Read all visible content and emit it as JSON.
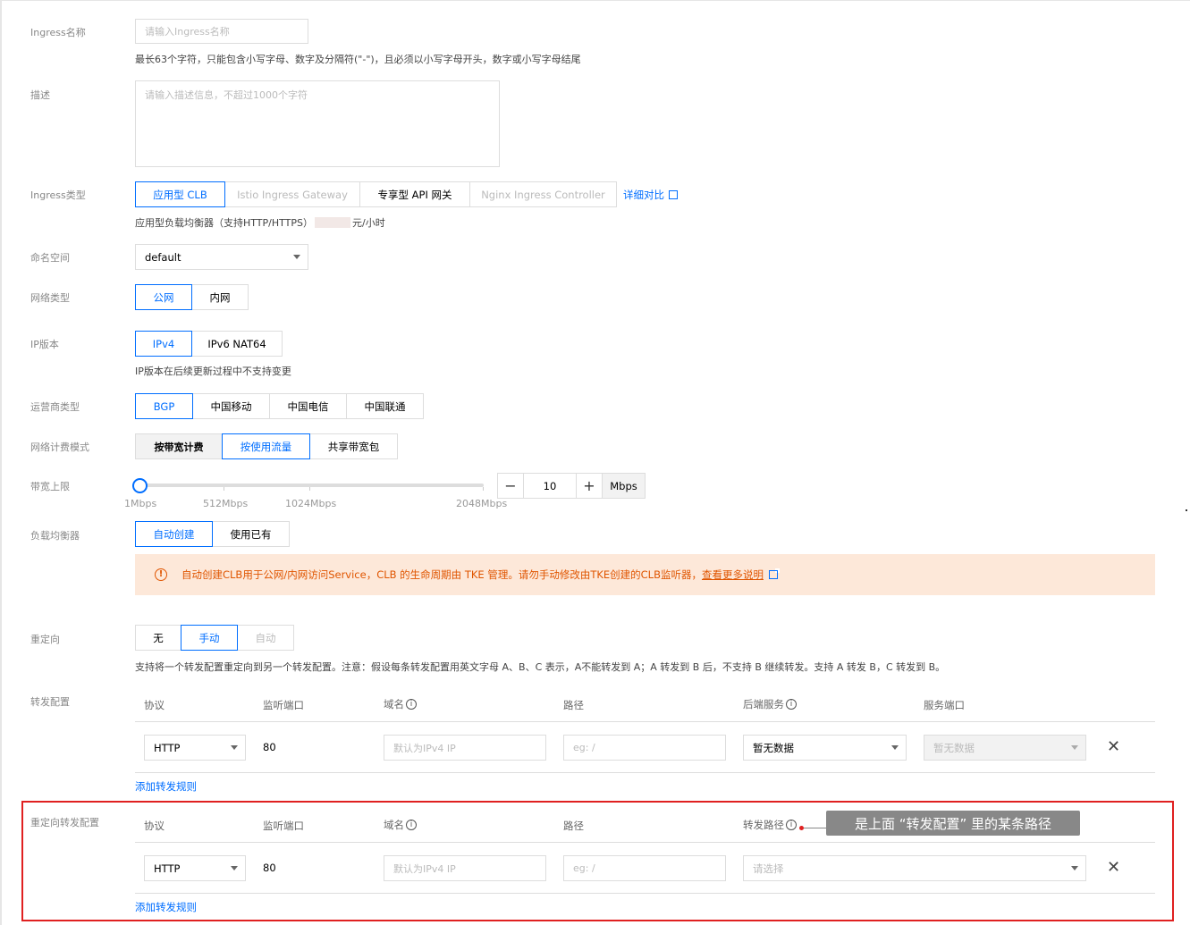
{
  "form": {
    "name": {
      "label": "Ingress名称",
      "placeholder": "请输入Ingress名称",
      "hint": "最长63个字符，只能包含小写字母、数字及分隔符(\"-\")，且必须以小写字母开头，数字或小写字母结尾"
    },
    "description": {
      "label": "描述",
      "placeholder": "请输入描述信息，不超过1000个字符"
    },
    "ingress_type": {
      "label": "Ingress类型",
      "options": [
        "应用型 CLB",
        "Istio Ingress Gateway",
        "专享型 API 网关",
        "Nginx Ingress Controller"
      ],
      "selected": "应用型 CLB",
      "compare_link": "详细对比",
      "hint_prefix": "应用型负载均衡器（支持HTTP/HTTPS）",
      "hint_suffix": "元/小时"
    },
    "namespace": {
      "label": "命名空间",
      "value": "default"
    },
    "network_type": {
      "label": "网络类型",
      "options": [
        "公网",
        "内网"
      ],
      "selected": "公网"
    },
    "ip_version": {
      "label": "IP版本",
      "options": [
        "IPv4",
        "IPv6 NAT64"
      ],
      "selected": "IPv4",
      "hint": "IP版本在后续更新过程中不支持变更"
    },
    "isp": {
      "label": "运营商类型",
      "options": [
        "BGP",
        "中国移动",
        "中国电信",
        "中国联通"
      ],
      "selected": "BGP"
    },
    "billing": {
      "label": "网络计费模式",
      "options": [
        "按带宽计费",
        "按使用流量",
        "共享带宽包"
      ],
      "selected": "按使用流量"
    },
    "bandwidth": {
      "label": "带宽上限",
      "ticks": [
        "1Mbps",
        "512Mbps",
        "1024Mbps",
        "2048Mbps"
      ],
      "value": "10",
      "unit": "Mbps",
      "minus": "−",
      "plus": "+",
      "level": 0
    },
    "load_balancer": {
      "label": "负载均衡器",
      "options": [
        "自动创建",
        "使用已有"
      ],
      "selected": "自动创建",
      "alert_text": "自动创建CLB用于公网/内网访问Service，CLB 的生命周期由 TKE 管理。请勿手动修改由TKE创建的CLB监听器，",
      "alert_link": "查看更多说明"
    },
    "redirect": {
      "label": "重定向",
      "options": [
        "无",
        "手动",
        "自动"
      ],
      "selected": "手动",
      "hint": "支持将一个转发配置重定向到另一个转发配置。注意：假设每条转发配置用英文字母 A、B、C 表示，A不能转发到 A；A 转发到 B 后，不支持 B 继续转发。支持 A 转发 B，C 转发到 B。"
    },
    "forward_config": {
      "label": "转发配置",
      "headers": {
        "protocol": "协议",
        "port": "监听端口",
        "domain": "域名",
        "path": "路径",
        "backend": "后端服务",
        "service_port": "服务端口"
      },
      "row": {
        "protocol": "HTTP",
        "port": "80",
        "domain_placeholder": "默认为IPv4 IP",
        "path_placeholder": "eg: /",
        "backend": "暂无数据",
        "service_port": "暂无数据"
      },
      "add_rule": "添加转发规则"
    },
    "redirect_config": {
      "label": "重定向转发配置",
      "headers": {
        "protocol": "协议",
        "port": "监听端口",
        "domain": "域名",
        "path": "路径",
        "forward_path": "转发路径"
      },
      "row": {
        "protocol": "HTTP",
        "port": "80",
        "domain_placeholder": "默认为IPv4 IP",
        "path_placeholder": "eg: /",
        "forward_path_placeholder": "请选择"
      },
      "add_rule": "添加转发规则",
      "annotation": "是上面 “转发配置” 里的某条路径"
    }
  },
  "colors": {
    "primary": "#006eff",
    "alert_bg": "#fde8d9",
    "highlight_border": "#e02020",
    "annotation_bg": "#888888"
  },
  "icons": {
    "remove": "close-icon",
    "info": "info-icon",
    "external": "external-link-icon",
    "warning": "warning-icon"
  }
}
